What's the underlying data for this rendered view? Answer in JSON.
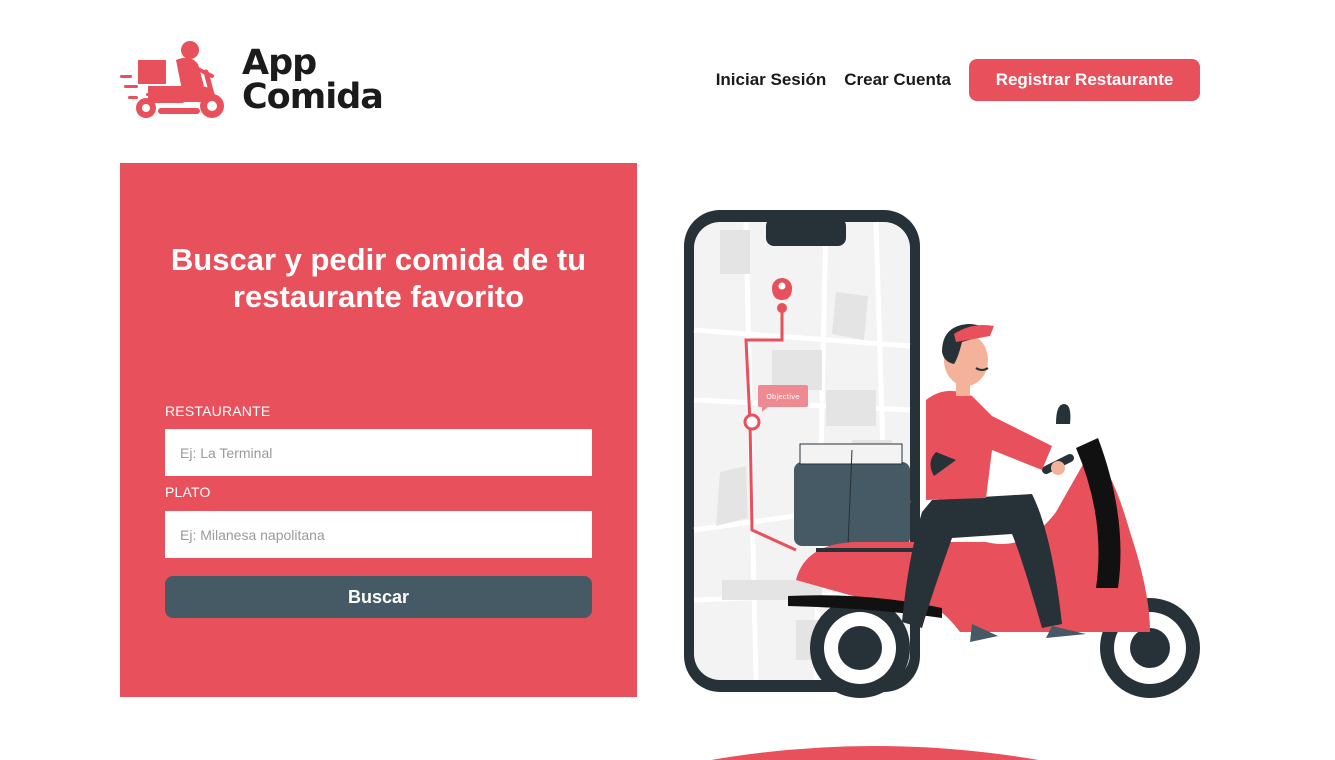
{
  "brand": {
    "name_line1": "App",
    "name_line2": "Comida",
    "logo_icon": "delivery-scooter-icon"
  },
  "nav": {
    "login": "Iniciar Sesión",
    "signup": "Crear Cuenta",
    "register_restaurant": "Registrar Restaurante"
  },
  "search": {
    "title": "Buscar y pedir comida de tu restaurante favorito",
    "restaurant_label": "RESTAURANTE",
    "restaurant_placeholder": "Ej: La Terminal",
    "restaurant_value": "",
    "dish_label": "PLATO",
    "dish_placeholder": "Ej: Milanesa napolitana",
    "dish_value": "",
    "submit": "Buscar"
  },
  "illustration": {
    "map_bubble": "Objective",
    "icon": "delivery-man-scooter-phone-illustration"
  },
  "colors": {
    "accent": "#e8505b",
    "button_dark": "#455a64",
    "text": "#1a1a1a",
    "background": "#ffffff"
  }
}
